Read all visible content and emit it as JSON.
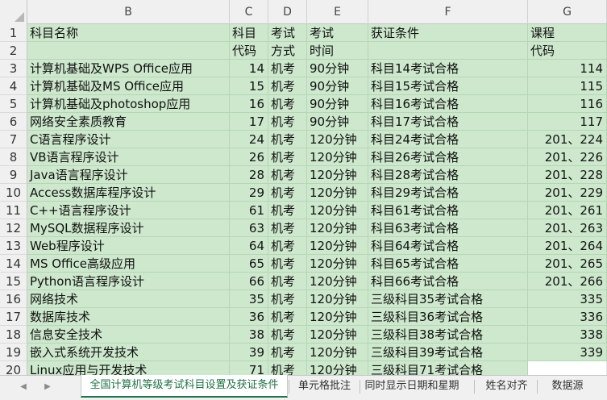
{
  "columns": [
    "B",
    "C",
    "D",
    "E",
    "F",
    "G"
  ],
  "sheet_tabs": [
    {
      "label": "全国计算机等级考试科目设置及获证条件",
      "active": true
    },
    {
      "label": "单元格批注",
      "active": false
    },
    {
      "label": "同时显示日期和星期",
      "active": false
    },
    {
      "label": "姓名对齐",
      "active": false
    },
    {
      "label": "数据源",
      "active": false
    }
  ],
  "header_rows": [
    {
      "num": "1",
      "cells": [
        "科目名称",
        "科目",
        "考试",
        "考试",
        "获证条件",
        "课程"
      ]
    },
    {
      "num": "2",
      "cells": [
        "",
        "代码",
        "方式",
        "时间",
        "",
        "代码"
      ]
    }
  ],
  "rows": [
    {
      "num": "3",
      "name": "计算机基础及WPS Office应用",
      "code": "14",
      "method": "机考",
      "time": "90分钟",
      "cond": "科目14考试合格",
      "course": "114"
    },
    {
      "num": "4",
      "name": "计算机基础及MS Office应用",
      "code": "15",
      "method": "机考",
      "time": "90分钟",
      "cond": "科目15考试合格",
      "course": "115"
    },
    {
      "num": "5",
      "name": "计算机基础及photoshop应用",
      "code": "16",
      "method": "机考",
      "time": "90分钟",
      "cond": "科目16考试合格",
      "course": "116"
    },
    {
      "num": "6",
      "name": "网络安全素质教育",
      "code": "17",
      "method": "机考",
      "time": "90分钟",
      "cond": "科目17考试合格",
      "course": "117"
    },
    {
      "num": "7",
      "name": "C语言程序设计",
      "code": "24",
      "method": "机考",
      "time": "120分钟",
      "cond": "科目24考试合格",
      "course": "201、224"
    },
    {
      "num": "8",
      "name": "VB语言程序设计",
      "code": "26",
      "method": "机考",
      "time": "120分钟",
      "cond": "科目26考试合格",
      "course": "201、226"
    },
    {
      "num": "9",
      "name": "Java语言程序设计",
      "code": "28",
      "method": "机考",
      "time": "120分钟",
      "cond": "科目28考试合格",
      "course": "201、228"
    },
    {
      "num": "10",
      "name": "Access数据库程序设计",
      "code": "29",
      "method": "机考",
      "time": "120分钟",
      "cond": "科目29考试合格",
      "course": "201、229"
    },
    {
      "num": "11",
      "name": "C++语言程序设计",
      "code": "61",
      "method": "机考",
      "time": "120分钟",
      "cond": "科目61考试合格",
      "course": "201、261"
    },
    {
      "num": "12",
      "name": "MySQL数据程序设计",
      "code": "63",
      "method": "机考",
      "time": "120分钟",
      "cond": "科目63考试合格",
      "course": "201、263"
    },
    {
      "num": "13",
      "name": "Web程序设计",
      "code": "64",
      "method": "机考",
      "time": "120分钟",
      "cond": "科目64考试合格",
      "course": "201、264"
    },
    {
      "num": "14",
      "name": "MS Office高级应用",
      "code": "65",
      "method": "机考",
      "time": "120分钟",
      "cond": "科目65考试合格",
      "course": "201、265"
    },
    {
      "num": "15",
      "name": "Python语言程序设计",
      "code": "66",
      "method": "机考",
      "time": "120分钟",
      "cond": "科目66考试合格",
      "course": "201、266"
    },
    {
      "num": "16",
      "name": "网络技术",
      "code": "35",
      "method": "机考",
      "time": "120分钟",
      "cond": "三级科目35考试合格",
      "course": "335"
    },
    {
      "num": "17",
      "name": "数据库技术",
      "code": "36",
      "method": "机考",
      "time": "120分钟",
      "cond": "三级科目36考试合格",
      "course": "336"
    },
    {
      "num": "18",
      "name": "信息安全技术",
      "code": "38",
      "method": "机考",
      "time": "120分钟",
      "cond": "三级科目38考试合格",
      "course": "338"
    },
    {
      "num": "19",
      "name": "嵌入式系统开发技术",
      "code": "39",
      "method": "机考",
      "time": "120分钟",
      "cond": "三级科目39考试合格",
      "course": "339"
    },
    {
      "num": "20",
      "name": "Linux应用与开发技术",
      "code": "71",
      "method": "机考",
      "time": "120分钟",
      "cond": "三级科目71考试合格",
      "course": ""
    }
  ],
  "colors": {
    "cell_fill": "#cde8cd",
    "active_tab": "#217346"
  }
}
